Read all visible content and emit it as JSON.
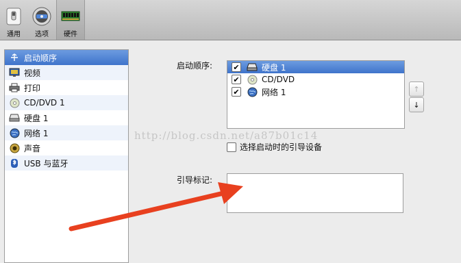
{
  "toolbar": {
    "items": [
      {
        "label": "通用",
        "icon": "general-switch-icon"
      },
      {
        "label": "选项",
        "icon": "options-disc-icon"
      },
      {
        "label": "硬件",
        "icon": "hardware-chip-icon",
        "selected": true
      }
    ]
  },
  "sidebar": {
    "items": [
      {
        "label": "启动顺序",
        "icon": "startup-order-icon",
        "selected": true
      },
      {
        "label": "视频",
        "icon": "monitor-icon"
      },
      {
        "label": "打印",
        "icon": "printer-icon"
      },
      {
        "label": "CD/DVD 1",
        "icon": "cd-icon"
      },
      {
        "label": "硬盘 1",
        "icon": "hard-disk-icon"
      },
      {
        "label": "网络 1",
        "icon": "globe-icon"
      },
      {
        "label": "声音",
        "icon": "speaker-icon"
      },
      {
        "label": "USB 与蓝牙",
        "icon": "usb-bluetooth-icon"
      }
    ]
  },
  "main": {
    "boot_order_label": "启动顺序:",
    "boot_items": [
      {
        "label": "硬盘 1",
        "checked": true,
        "selected": true,
        "icon": "hard-disk-icon"
      },
      {
        "label": "CD/DVD",
        "checked": true,
        "selected": false,
        "icon": "cd-icon"
      },
      {
        "label": "网络 1",
        "checked": true,
        "selected": false,
        "icon": "globe-icon"
      }
    ],
    "move_up_icon": "↑",
    "move_down_icon": "↓",
    "select_boot_device_label": "选择启动时的引导设备",
    "select_boot_device_checked": false,
    "boot_flags_label": "引导标记:",
    "boot_flags_value": ""
  },
  "watermark": "http://blog.csdn.net/a87b01c14",
  "colors": {
    "selection": "#3f74cb",
    "arrow": "#e8401f"
  }
}
